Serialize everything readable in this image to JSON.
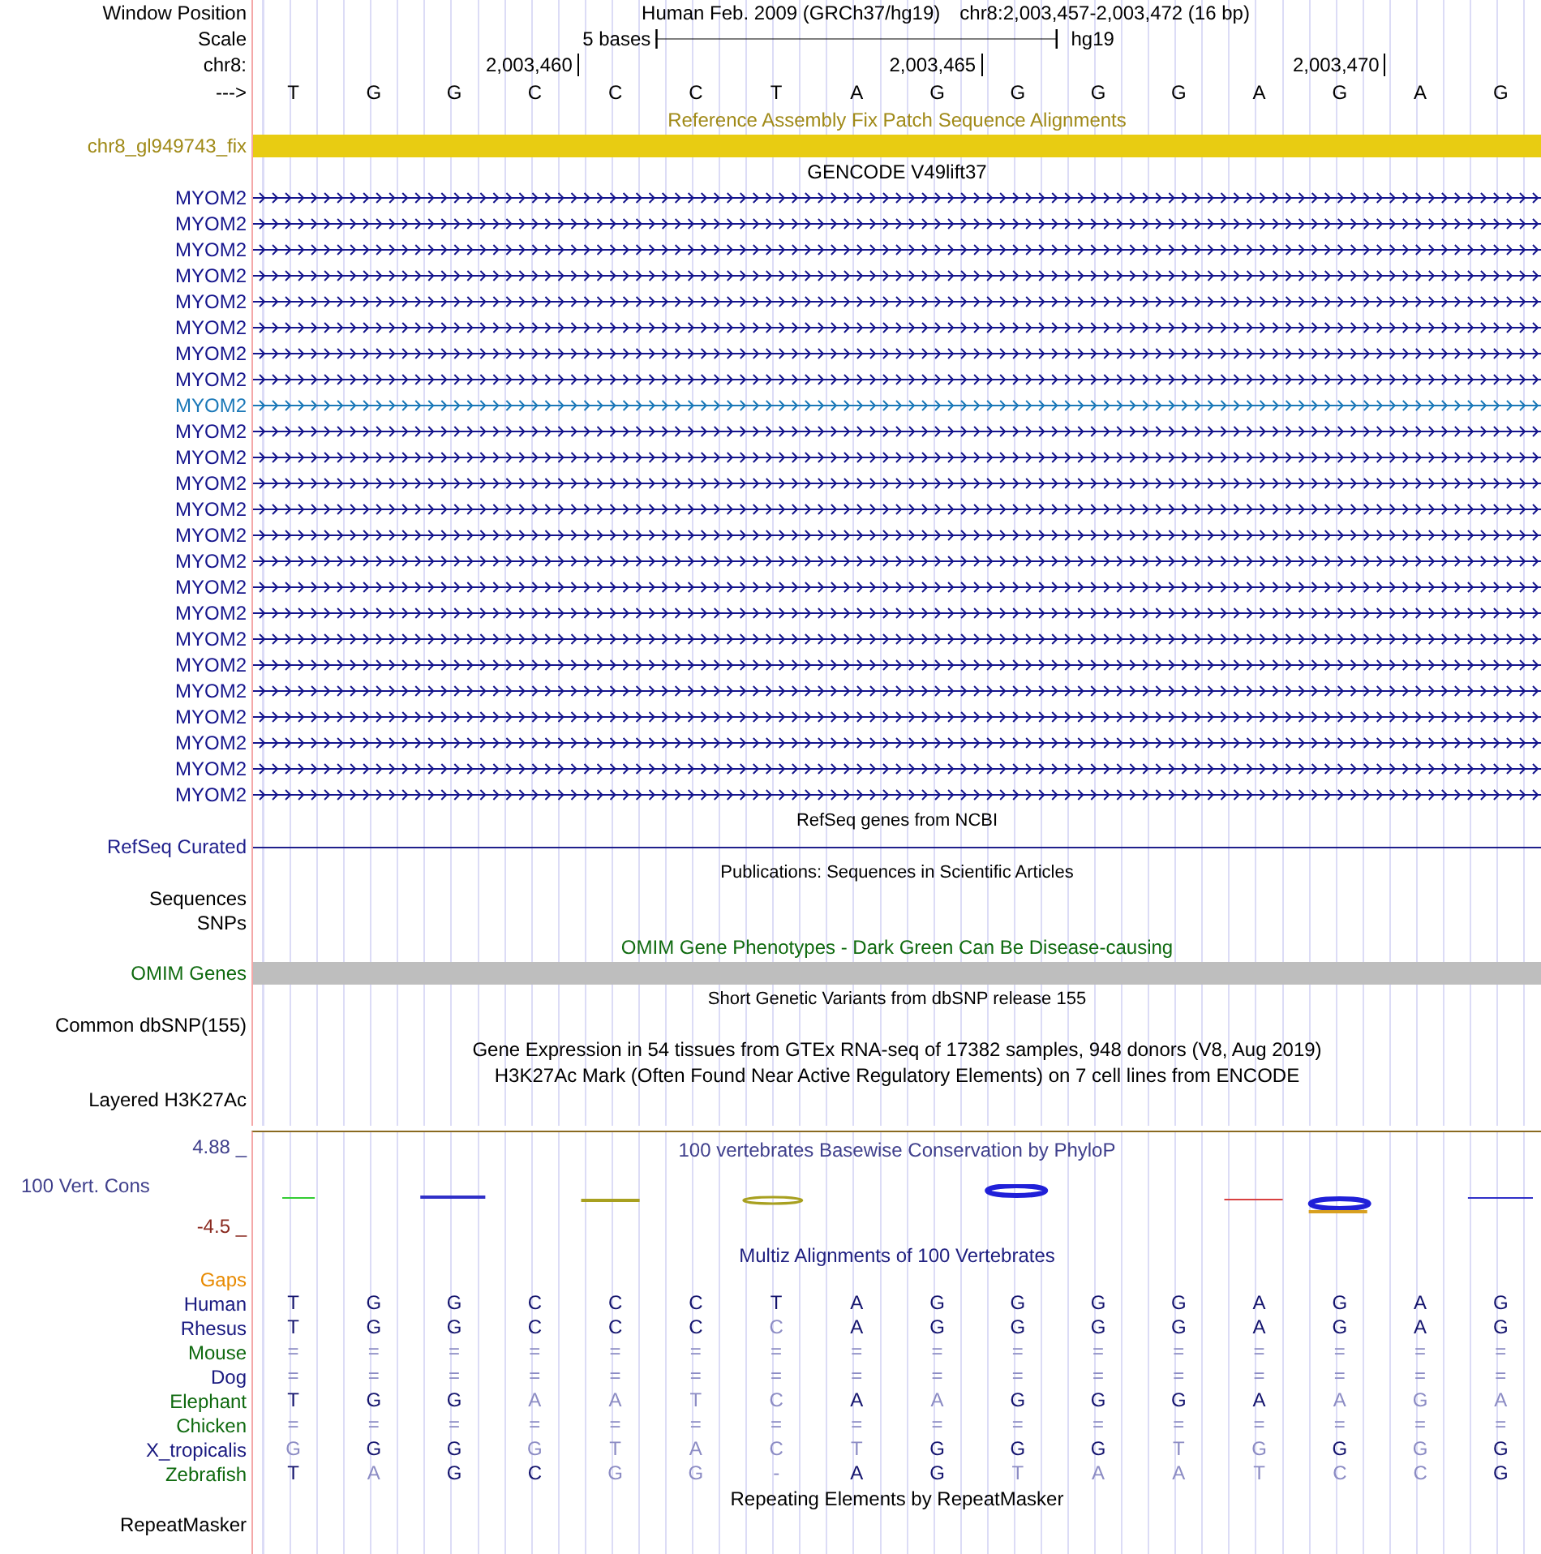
{
  "header": {
    "position_label": "Window Position",
    "assembly": "Human Feb. 2009 (GRCh37/hg19)",
    "range": "chr8:2,003,457-2,003,472 (16 bp)",
    "scale_label": "Scale",
    "scale_span": "5 bases",
    "scale_assembly": "hg19",
    "chrom_label": "chr8:",
    "strand_label": "--->"
  },
  "bases": [
    {
      "base": "T"
    },
    {
      "base": "G"
    },
    {
      "base": "G"
    },
    {
      "base": "C",
      "tick": "2,003,460"
    },
    {
      "base": "C"
    },
    {
      "base": "C"
    },
    {
      "base": "T"
    },
    {
      "base": "A"
    },
    {
      "base": "G",
      "tick": "2,003,465"
    },
    {
      "base": "G"
    },
    {
      "base": "G"
    },
    {
      "base": "G"
    },
    {
      "base": "A"
    },
    {
      "base": "G",
      "tick": "2,003,470"
    },
    {
      "base": "A"
    },
    {
      "base": "G"
    }
  ],
  "tracks": [
    {
      "kind": "title",
      "text": "Reference Assembly Fix Patch Sequence Alignments",
      "color": "#a08a18"
    },
    {
      "kind": "bar",
      "label": "chr8_gl949743_fix",
      "color": "#a08a18",
      "bar": {
        "color": "#e8cc12"
      }
    },
    {
      "kind": "title",
      "text": "GENCODE V49lift37",
      "color": "#000000"
    },
    {
      "kind": "gene",
      "label": "MYOM2",
      "highlighted": false
    },
    {
      "kind": "gene",
      "label": "MYOM2",
      "highlighted": false
    },
    {
      "kind": "gene",
      "label": "MYOM2",
      "highlighted": false
    },
    {
      "kind": "gene",
      "label": "MYOM2",
      "highlighted": false
    },
    {
      "kind": "gene",
      "label": "MYOM2",
      "highlighted": false
    },
    {
      "kind": "gene",
      "label": "MYOM2",
      "highlighted": false
    },
    {
      "kind": "gene",
      "label": "MYOM2",
      "highlighted": false
    },
    {
      "kind": "gene",
      "label": "MYOM2",
      "highlighted": false
    },
    {
      "kind": "gene",
      "label": "MYOM2",
      "highlighted": true
    },
    {
      "kind": "gene",
      "label": "MYOM2",
      "highlighted": false
    },
    {
      "kind": "gene",
      "label": "MYOM2",
      "highlighted": false
    },
    {
      "kind": "gene",
      "label": "MYOM2",
      "highlighted": false
    },
    {
      "kind": "gene",
      "label": "MYOM2",
      "highlighted": false
    },
    {
      "kind": "gene",
      "label": "MYOM2",
      "highlighted": false
    },
    {
      "kind": "gene",
      "label": "MYOM2",
      "highlighted": false
    },
    {
      "kind": "gene",
      "label": "MYOM2",
      "highlighted": false
    },
    {
      "kind": "gene",
      "label": "MYOM2",
      "highlighted": false
    },
    {
      "kind": "gene",
      "label": "MYOM2",
      "highlighted": false
    },
    {
      "kind": "gene",
      "label": "MYOM2",
      "highlighted": false
    },
    {
      "kind": "gene",
      "label": "MYOM2",
      "highlighted": false
    },
    {
      "kind": "gene",
      "label": "MYOM2",
      "highlighted": false
    },
    {
      "kind": "gene",
      "label": "MYOM2",
      "highlighted": false
    },
    {
      "kind": "gene",
      "label": "MYOM2",
      "highlighted": false
    },
    {
      "kind": "gene",
      "label": "MYOM2",
      "highlighted": false
    },
    {
      "kind": "small_title",
      "text": "RefSeq genes from NCBI",
      "color": "#000000"
    },
    {
      "kind": "line",
      "label": "RefSeq Curated",
      "color": "#20208c"
    },
    {
      "kind": "small_title",
      "text": "Publications: Sequences in Scientific Articles",
      "color": "#000000"
    },
    {
      "kind": "label",
      "label": "Sequences",
      "color": "#000000"
    },
    {
      "kind": "label",
      "label": "SNPs",
      "color": "#000000"
    },
    {
      "kind": "title",
      "text": "OMIM Gene Phenotypes - Dark Green Can Be Disease-causing",
      "color": "#0f6a0f"
    },
    {
      "kind": "bar",
      "label": "OMIM Genes",
      "color": "#0f6a0f",
      "bar": {
        "color": "#bebebe"
      }
    },
    {
      "kind": "small_title",
      "text": "Short Genetic Variants from dbSNP release 155",
      "color": "#000000"
    },
    {
      "kind": "label",
      "label": "Common dbSNP(155)",
      "color": "#000000"
    },
    {
      "kind": "title",
      "text": "Gene Expression in 54 tissues from GTEx RNA-seq of 17382 samples, 948 donors (V8, Aug 2019)",
      "color": "#000000"
    },
    {
      "kind": "title",
      "text": "H3K27Ac Mark (Often Found Near Active Regulatory Elements) on 7 cell lines from ENCODE",
      "color": "#000000"
    },
    {
      "kind": "tall_label",
      "label": "Layered H3K27Ac",
      "color": "#000000"
    }
  ],
  "conservation": {
    "title": "100 vertebrates Basewise Conservation by PhyloP",
    "label": "100 Vert. Cons",
    "y_max": "4.88 _",
    "y_min": "-4.5 _"
  },
  "multiz": {
    "title": "Multiz Alignments of 100 Vertebrates",
    "gaps_label": "Gaps",
    "species": [
      {
        "name": "Human",
        "color": "#1a1a80",
        "bases": [
          {
            "base": "T",
            "match": true
          },
          {
            "base": "G",
            "match": true
          },
          {
            "base": "G",
            "match": true
          },
          {
            "base": "C",
            "match": true
          },
          {
            "base": "C",
            "match": true
          },
          {
            "base": "C",
            "match": true
          },
          {
            "base": "T",
            "match": true
          },
          {
            "base": "A",
            "match": true
          },
          {
            "base": "G",
            "match": true
          },
          {
            "base": "G",
            "match": true
          },
          {
            "base": "G",
            "match": true
          },
          {
            "base": "G",
            "match": true
          },
          {
            "base": "A",
            "match": true
          },
          {
            "base": "G",
            "match": true
          },
          {
            "base": "A",
            "match": true
          },
          {
            "base": "G",
            "match": true
          }
        ]
      },
      {
        "name": "Rhesus",
        "color": "#1a1a80",
        "bases": [
          {
            "base": "T",
            "match": true
          },
          {
            "base": "G",
            "match": true
          },
          {
            "base": "G",
            "match": true
          },
          {
            "base": "C",
            "match": true
          },
          {
            "base": "C",
            "match": true
          },
          {
            "base": "C",
            "match": true
          },
          {
            "base": "C",
            "match": false
          },
          {
            "base": "A",
            "match": true
          },
          {
            "base": "G",
            "match": true
          },
          {
            "base": "G",
            "match": true
          },
          {
            "base": "G",
            "match": true
          },
          {
            "base": "G",
            "match": true
          },
          {
            "base": "A",
            "match": true
          },
          {
            "base": "G",
            "match": true
          },
          {
            "base": "A",
            "match": true
          },
          {
            "base": "G",
            "match": true
          }
        ]
      },
      {
        "name": "Mouse",
        "color": "#0f6a0f",
        "bases": [
          {
            "base": "=",
            "match": false
          },
          {
            "base": "=",
            "match": false
          },
          {
            "base": "=",
            "match": false
          },
          {
            "base": "=",
            "match": false
          },
          {
            "base": "=",
            "match": false
          },
          {
            "base": "=",
            "match": false
          },
          {
            "base": "=",
            "match": false
          },
          {
            "base": "=",
            "match": false
          },
          {
            "base": "=",
            "match": false
          },
          {
            "base": "=",
            "match": false
          },
          {
            "base": "=",
            "match": false
          },
          {
            "base": "=",
            "match": false
          },
          {
            "base": "=",
            "match": false
          },
          {
            "base": "=",
            "match": false
          },
          {
            "base": "=",
            "match": false
          },
          {
            "base": "=",
            "match": false
          }
        ]
      },
      {
        "name": "Dog",
        "color": "#1a1a80",
        "bases": [
          {
            "base": "=",
            "match": false
          },
          {
            "base": "=",
            "match": false
          },
          {
            "base": "=",
            "match": false
          },
          {
            "base": "=",
            "match": false
          },
          {
            "base": "=",
            "match": false
          },
          {
            "base": "=",
            "match": false
          },
          {
            "base": "=",
            "match": false
          },
          {
            "base": "=",
            "match": false
          },
          {
            "base": "=",
            "match": false
          },
          {
            "base": "=",
            "match": false
          },
          {
            "base": "=",
            "match": false
          },
          {
            "base": "=",
            "match": false
          },
          {
            "base": "=",
            "match": false
          },
          {
            "base": "=",
            "match": false
          },
          {
            "base": "=",
            "match": false
          },
          {
            "base": "=",
            "match": false
          }
        ]
      },
      {
        "name": "Elephant",
        "color": "#0f6a0f",
        "bases": [
          {
            "base": "T",
            "match": true
          },
          {
            "base": "G",
            "match": true
          },
          {
            "base": "G",
            "match": true
          },
          {
            "base": "A",
            "match": false
          },
          {
            "base": "A",
            "match": false
          },
          {
            "base": "T",
            "match": false
          },
          {
            "base": "C",
            "match": false
          },
          {
            "base": "A",
            "match": true
          },
          {
            "base": "A",
            "match": false
          },
          {
            "base": "G",
            "match": true
          },
          {
            "base": "G",
            "match": true
          },
          {
            "base": "G",
            "match": true
          },
          {
            "base": "A",
            "match": true
          },
          {
            "base": "A",
            "match": false
          },
          {
            "base": "G",
            "match": false
          },
          {
            "base": "A",
            "match": false
          }
        ]
      },
      {
        "name": "Chicken",
        "color": "#0f6a0f",
        "bases": [
          {
            "base": "=",
            "match": false
          },
          {
            "base": "=",
            "match": false
          },
          {
            "base": "=",
            "match": false
          },
          {
            "base": "=",
            "match": false
          },
          {
            "base": "=",
            "match": false
          },
          {
            "base": "=",
            "match": false
          },
          {
            "base": "=",
            "match": false
          },
          {
            "base": "=",
            "match": false
          },
          {
            "base": "=",
            "match": false
          },
          {
            "base": "=",
            "match": false
          },
          {
            "base": "=",
            "match": false
          },
          {
            "base": "=",
            "match": false
          },
          {
            "base": "=",
            "match": false
          },
          {
            "base": "=",
            "match": false
          },
          {
            "base": "=",
            "match": false
          },
          {
            "base": "=",
            "match": false
          }
        ]
      },
      {
        "name": "X_tropicalis",
        "color": "#1a1a80",
        "bases": [
          {
            "base": "G",
            "match": false
          },
          {
            "base": "G",
            "match": true
          },
          {
            "base": "G",
            "match": true
          },
          {
            "base": "G",
            "match": false
          },
          {
            "base": "T",
            "match": false
          },
          {
            "base": "A",
            "match": false
          },
          {
            "base": "C",
            "match": false
          },
          {
            "base": "T",
            "match": false
          },
          {
            "base": "G",
            "match": true
          },
          {
            "base": "G",
            "match": true
          },
          {
            "base": "G",
            "match": true
          },
          {
            "base": "T",
            "match": false
          },
          {
            "base": "G",
            "match": false
          },
          {
            "base": "G",
            "match": true
          },
          {
            "base": "G",
            "match": false
          },
          {
            "base": "G",
            "match": true
          }
        ]
      },
      {
        "name": "Zebrafish",
        "color": "#0f6a0f",
        "bases": [
          {
            "base": "T",
            "match": true
          },
          {
            "base": "A",
            "match": false
          },
          {
            "base": "G",
            "match": true
          },
          {
            "base": "C",
            "match": true
          },
          {
            "base": "G",
            "match": false
          },
          {
            "base": "G",
            "match": false
          },
          {
            "base": "-",
            "match": false
          },
          {
            "base": "A",
            "match": true
          },
          {
            "base": "G",
            "match": true
          },
          {
            "base": "T",
            "match": false
          },
          {
            "base": "A",
            "match": false
          },
          {
            "base": "A",
            "match": false
          },
          {
            "base": "T",
            "match": false
          },
          {
            "base": "C",
            "match": false
          },
          {
            "base": "C",
            "match": false
          },
          {
            "base": "G",
            "match": true
          }
        ]
      }
    ]
  },
  "repeats": {
    "title": "Repeating Elements by RepeatMasker",
    "label": "RepeatMasker"
  }
}
